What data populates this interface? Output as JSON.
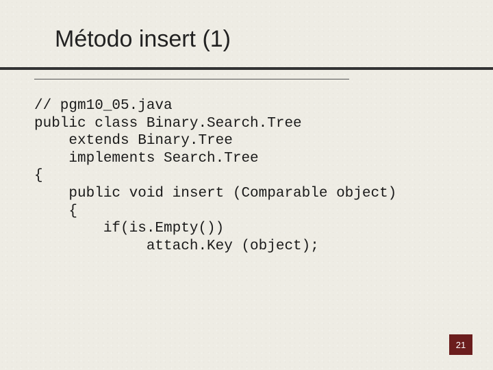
{
  "title": "Método insert (1)",
  "code": "// pgm10_05.java\npublic class Binary.Search.Tree\n    extends Binary.Tree\n    implements Search.Tree\n{\n    public void insert (Comparable object)\n    {\n        if(is.Empty())\n             attach.Key (object);",
  "page_number": "21"
}
